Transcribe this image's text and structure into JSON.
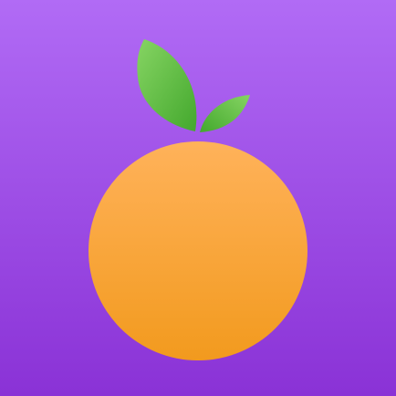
{
  "icon": {
    "subject": "orange-fruit-icon",
    "leaf_count": 2
  },
  "colors": {
    "background_top": "#B16BF5",
    "background_bottom": "#8A32D6",
    "fruit_light": "#FFB25A",
    "fruit_dark": "#F29A1E",
    "leaf_light": "#86D463",
    "leaf_dark": "#43A82D"
  }
}
